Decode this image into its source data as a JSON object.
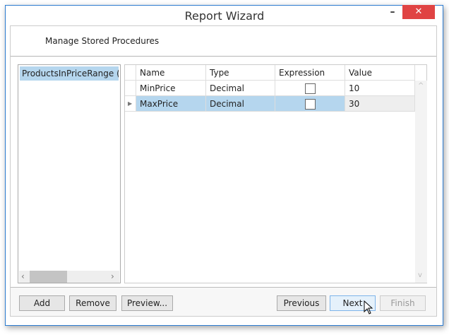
{
  "window": {
    "title": "Report Wizard",
    "minimize": "–",
    "close": "✕"
  },
  "header": {
    "title": "Manage Stored Procedures"
  },
  "procedures": [
    {
      "label": "ProductsInPriceRange (Mi",
      "selected": true
    }
  ],
  "grid": {
    "columns": [
      "Name",
      "Type",
      "Expression",
      "Value"
    ],
    "rows": [
      {
        "name": "MinPrice",
        "type": "Decimal",
        "expression": false,
        "value": "10"
      },
      {
        "name": "MaxPrice",
        "type": "Decimal",
        "expression": false,
        "value": "30",
        "selected": true
      }
    ]
  },
  "buttons": {
    "add": "Add",
    "remove": "Remove",
    "preview": "Preview...",
    "previous": "Previous",
    "next": "Next",
    "finish": "Finish"
  },
  "colors": {
    "selection": "#b5d6ee",
    "close": "#e04343"
  }
}
